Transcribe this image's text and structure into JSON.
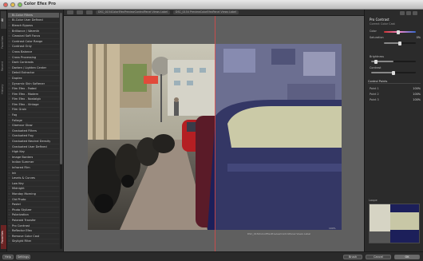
{
  "app": {
    "title": "Color Efex Pro"
  },
  "toolbar": {
    "info_left": "DSC_0154ColorEfexPreviewControlPanel Views Label",
    "info_mid": "DSC_0154 PreviewColorEfexPanel Views Label"
  },
  "sidebar": {
    "tabs": [
      "All",
      "Favorites",
      "Recent",
      "History"
    ],
    "favorites_tab": "Favorites",
    "filters": [
      "Bi-Color Filters",
      "Bi-Color User Defined",
      "Bleach Bypass",
      "Brilliance / Warmth",
      "Classical Soft Focus",
      "Contrast Color Range",
      "Contrast Only",
      "Cross Balance",
      "Cross Processing",
      "Dark Contrasts",
      "Darken / Lighten Center",
      "Detail Extractor",
      "Duplex",
      "Dynamic Skin Softener",
      "Film Efex - Faded",
      "Film Efex - Modern",
      "Film Efex - Nostalgic",
      "Film Efex - Vintage",
      "Film Grain",
      "Fog",
      "Foliage",
      "Glamour Glow",
      "Graduated Filters",
      "Graduated Fog",
      "Graduated Neutral Density",
      "Graduated User Defined",
      "High Key",
      "Image Borders",
      "Indian Summer",
      "Infrared Film",
      "Ink",
      "Levels & Curves",
      "Low Key",
      "Midnight",
      "Monday Morning",
      "Old Photo",
      "Pastel",
      "Photo Stylizer",
      "Polarization",
      "Polaroid Transfer",
      "Pro Contrast",
      "Reflector Efex",
      "Remove Color Cast",
      "Skylight Filter"
    ],
    "selected_index": 0
  },
  "preview": {
    "caption": "DSC_0154ColorEfexPreviewControlPanel Views Label",
    "dimensions": "100%"
  },
  "rpanel": {
    "title": "Pro Contrast",
    "subtitle": "Correct Color Cast",
    "rows": [
      {
        "label": "Color",
        "value": ""
      },
      {
        "label": "Saturation",
        "value": "0%"
      },
      {
        "label": "Brightness",
        "value": ""
      },
      {
        "label": "Contrast",
        "value": ""
      }
    ],
    "section_control_points": "Control Points",
    "points": [
      {
        "label": "Point 1",
        "value": "100%"
      },
      {
        "label": "Point 2",
        "value": "100%"
      },
      {
        "label": "Point 3",
        "value": "100%"
      }
    ],
    "navigator_label": "Loupe"
  },
  "bottom": {
    "help": "Help",
    "settings": "Settings",
    "brush": "Brush",
    "cancel": "Cancel",
    "ok": "OK"
  },
  "colors": {
    "accent": "#d74a4a",
    "panel": "#2b2b2b",
    "preview_bg": "#5f5f5f"
  }
}
